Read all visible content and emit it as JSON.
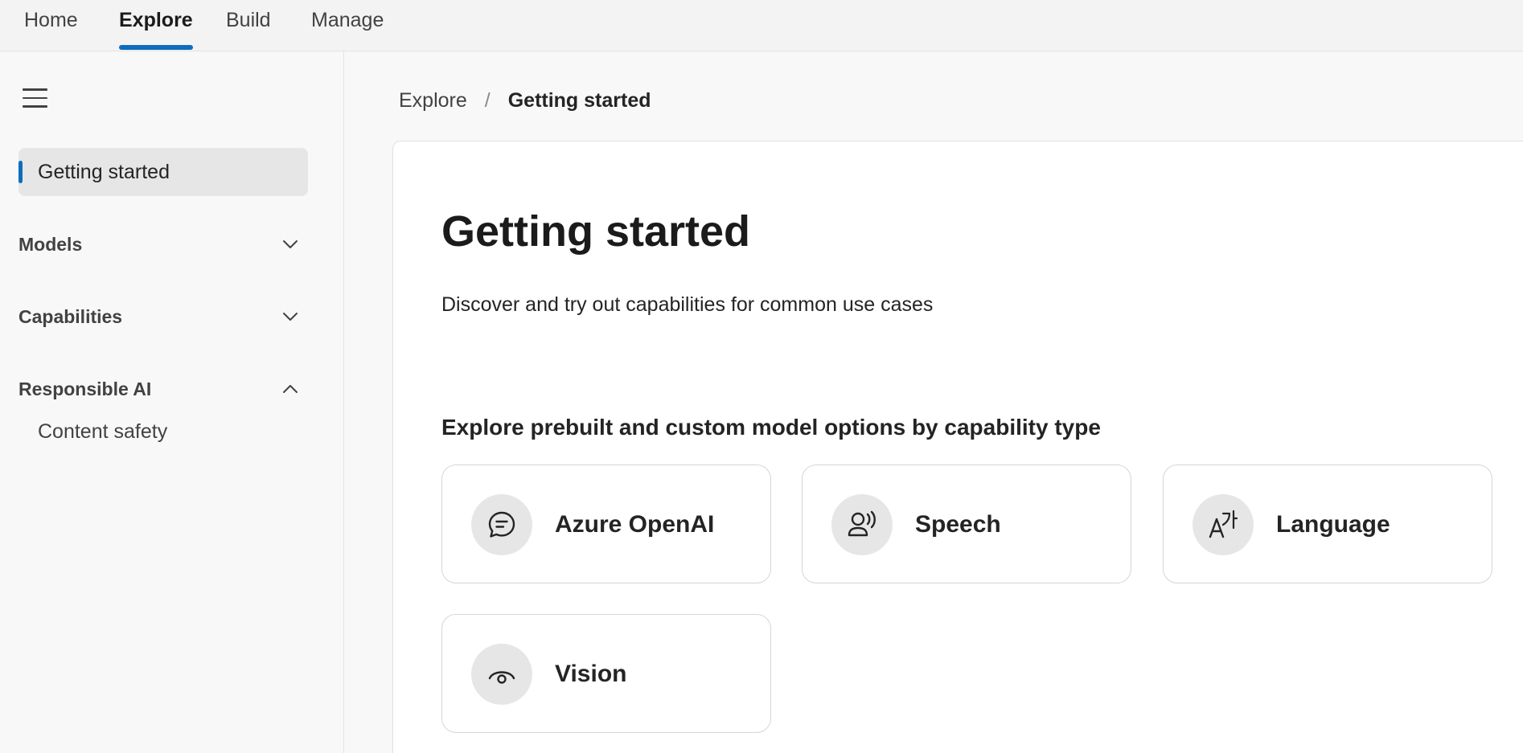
{
  "topnav": {
    "tabs": [
      {
        "label": "Home"
      },
      {
        "label": "Explore"
      },
      {
        "label": "Build"
      },
      {
        "label": "Manage"
      }
    ],
    "active": "Explore"
  },
  "sidebar": {
    "selected_item": "Getting started",
    "sections": [
      {
        "label": "Models",
        "expanded": false
      },
      {
        "label": "Capabilities",
        "expanded": false
      },
      {
        "label": "Responsible AI",
        "expanded": true,
        "items": [
          "Content safety"
        ]
      }
    ]
  },
  "breadcrumb": {
    "parent": "Explore",
    "separator": "/",
    "current": "Getting started"
  },
  "main": {
    "title": "Getting started",
    "subtitle": "Discover and try out capabilities for common use cases",
    "section_heading": "Explore prebuilt and custom model options by capability type",
    "cards": [
      {
        "label": "Azure OpenAI",
        "icon": "chat-bubble-icon"
      },
      {
        "label": "Speech",
        "icon": "person-voice-icon"
      },
      {
        "label": "Language",
        "icon": "translate-icon"
      },
      {
        "label": "Vision",
        "icon": "eye-icon"
      }
    ]
  },
  "colors": {
    "accent": "#0f6cbd",
    "background": "#f8f8f8",
    "card_icon_bg": "#e6e6e6"
  }
}
